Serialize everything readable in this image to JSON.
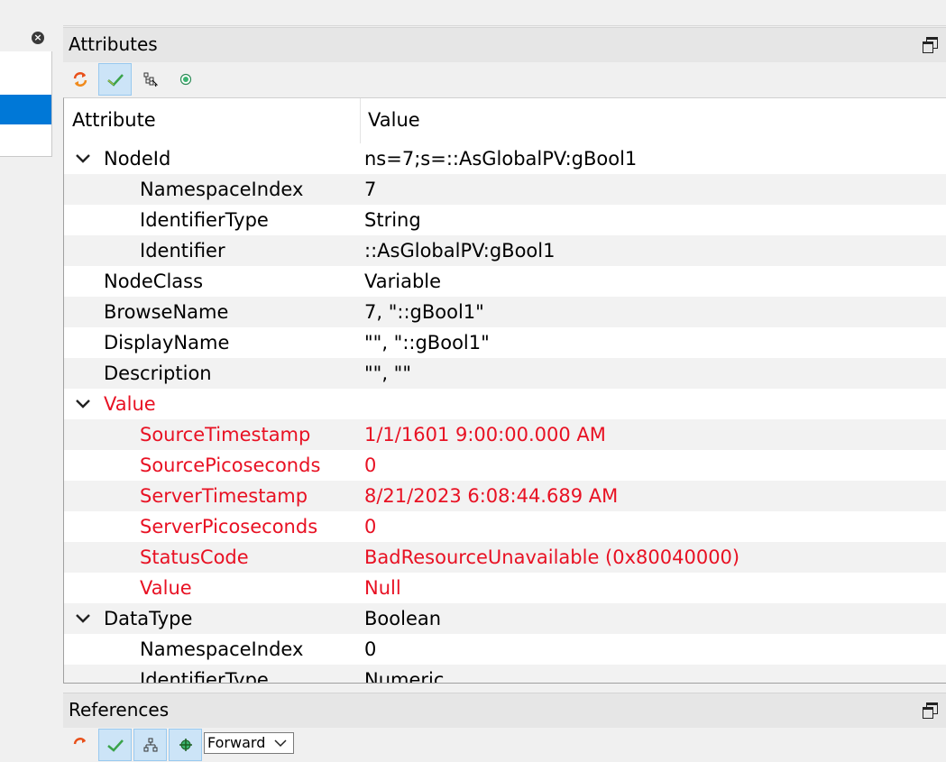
{
  "left_panel": {
    "close_glyph": "×"
  },
  "attributes_panel": {
    "title": "Attributes",
    "columns": {
      "attribute": "Attribute",
      "value": "Value"
    },
    "toolbar": [
      {
        "icon": "refresh-icon",
        "active": false
      },
      {
        "icon": "checkmark-icon",
        "active": true
      },
      {
        "icon": "tree-select-icon",
        "active": false
      },
      {
        "icon": "radio-target-icon",
        "active": false
      }
    ],
    "rows": [
      {
        "name": "NodeId",
        "value": "ns=7;s=::AsGlobalPV:gBool1",
        "level": 0,
        "expandable": true,
        "error": false
      },
      {
        "name": "NamespaceIndex",
        "value": "7",
        "level": 1,
        "expandable": false,
        "error": false
      },
      {
        "name": "IdentifierType",
        "value": "String",
        "level": 1,
        "expandable": false,
        "error": false
      },
      {
        "name": "Identifier",
        "value": "::AsGlobalPV:gBool1",
        "level": 1,
        "expandable": false,
        "error": false
      },
      {
        "name": "NodeClass",
        "value": "Variable",
        "level": 0,
        "expandable": false,
        "error": false
      },
      {
        "name": "BrowseName",
        "value": "7, \"::gBool1\"",
        "level": 0,
        "expandable": false,
        "error": false
      },
      {
        "name": "DisplayName",
        "value": "\"\", \"::gBool1\"",
        "level": 0,
        "expandable": false,
        "error": false
      },
      {
        "name": "Description",
        "value": "\"\", \"\"",
        "level": 0,
        "expandable": false,
        "error": false
      },
      {
        "name": "Value",
        "value": "",
        "level": 0,
        "expandable": true,
        "error": true
      },
      {
        "name": "SourceTimestamp",
        "value": "1/1/1601 9:00:00.000 AM",
        "level": 1,
        "expandable": false,
        "error": true
      },
      {
        "name": "SourcePicoseconds",
        "value": "0",
        "level": 1,
        "expandable": false,
        "error": true
      },
      {
        "name": "ServerTimestamp",
        "value": "8/21/2023 6:08:44.689 AM",
        "level": 1,
        "expandable": false,
        "error": true
      },
      {
        "name": "ServerPicoseconds",
        "value": "0",
        "level": 1,
        "expandable": false,
        "error": true
      },
      {
        "name": "StatusCode",
        "value": "BadResourceUnavailable (0x80040000)",
        "level": 1,
        "expandable": false,
        "error": true
      },
      {
        "name": "Value",
        "value": "Null",
        "level": 1,
        "expandable": false,
        "error": true
      },
      {
        "name": "DataType",
        "value": "Boolean",
        "level": 0,
        "expandable": true,
        "error": false
      },
      {
        "name": "NamespaceIndex",
        "value": "0",
        "level": 1,
        "expandable": false,
        "error": false
      },
      {
        "name": "IdentifierType",
        "value": "Numeric",
        "level": 1,
        "expandable": false,
        "error": false
      }
    ]
  },
  "references_panel": {
    "title": "References",
    "direction": "Forward",
    "toolbar": [
      {
        "icon": "refresh-icon",
        "active": false
      },
      {
        "icon": "checkmark-icon",
        "active": true
      },
      {
        "icon": "hierarchy-icon",
        "active": true
      },
      {
        "icon": "node-add-icon",
        "active": true
      }
    ]
  },
  "colors": {
    "error_text": "#e81123",
    "selection": "#0078d7",
    "active_button": "#cce4f7"
  }
}
